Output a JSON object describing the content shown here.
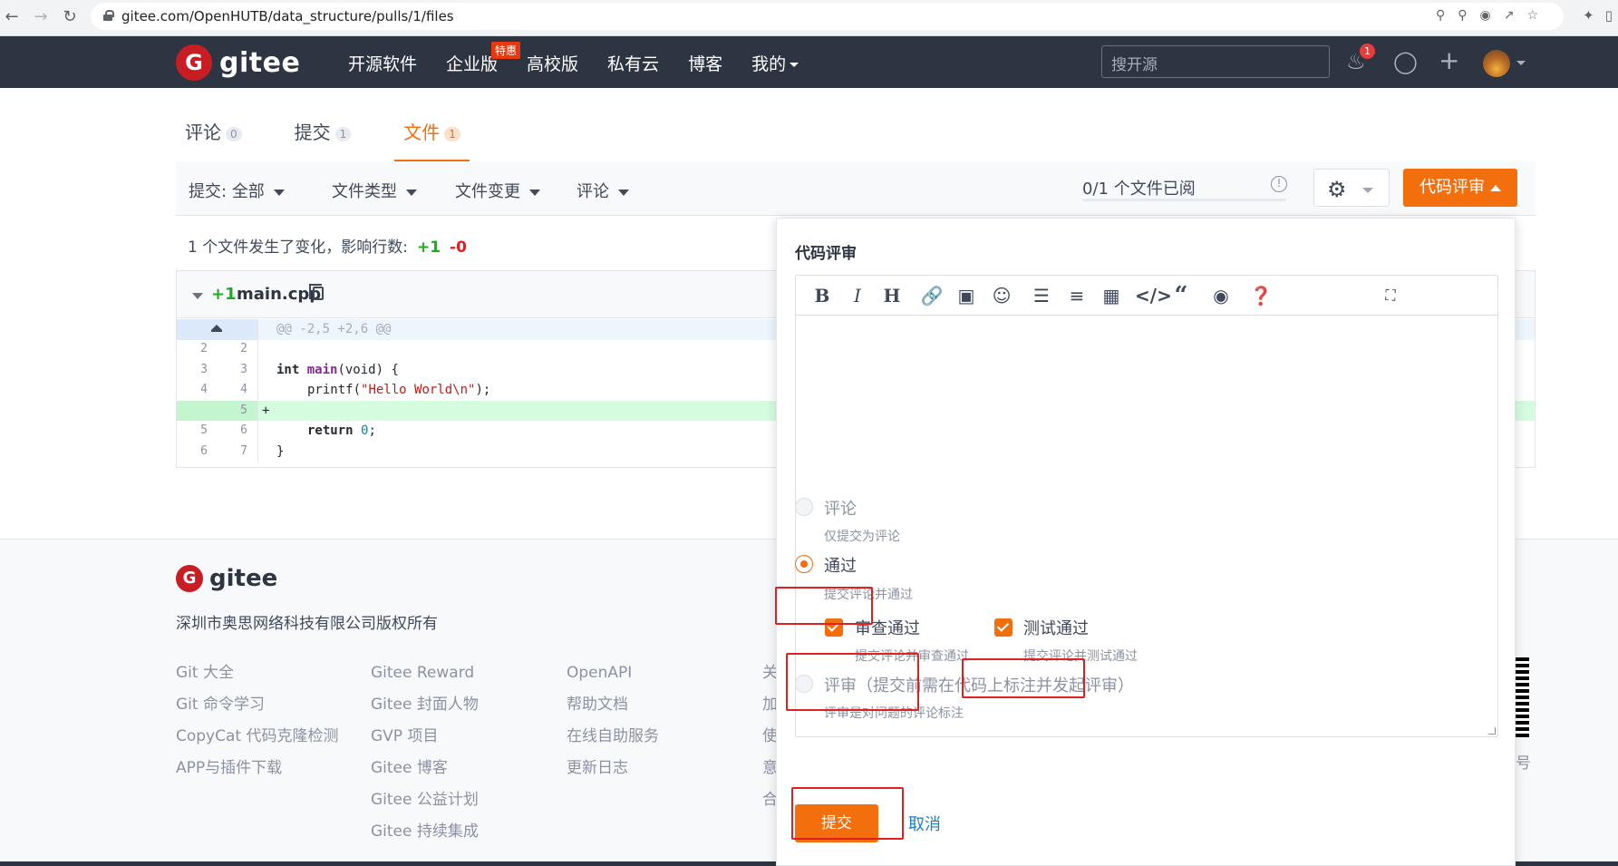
{
  "browser": {
    "url": "gitee.com/OpenHUTB/data_structure/pulls/1/files"
  },
  "header": {
    "logo_text": "gitee",
    "nav": [
      "开源软件",
      "企业版",
      "高校版",
      "私有云",
      "博客",
      "我的"
    ],
    "hot_tag": "特惠",
    "search_placeholder": "搜开源",
    "notification_count": "1"
  },
  "tabs": [
    {
      "label": "评论",
      "count": "0"
    },
    {
      "label": "提交",
      "count": "1"
    },
    {
      "label": "文件",
      "count": "1"
    }
  ],
  "filters": {
    "commit_label": "提交:",
    "commit_value": "全部",
    "file_type": "文件类型",
    "file_change": "文件变更",
    "comment": "评论",
    "read_status": "0/1 个文件已阅",
    "review_button": "代码评审"
  },
  "summary": {
    "text": "1 个文件发生了变化，影响行数:",
    "added": "+1",
    "removed": "-0"
  },
  "diff": {
    "added": "+1",
    "filename": "main.cpp",
    "hunk": "@@ -2,5 +2,6 @@",
    "lines": [
      {
        "old": "2",
        "new": "2"
      },
      {
        "old": "3",
        "new": "3"
      },
      {
        "old": "4",
        "new": "4"
      },
      {
        "old": "",
        "new": "5",
        "marker": "+"
      },
      {
        "old": "5",
        "new": "6"
      },
      {
        "old": "6",
        "new": "7"
      }
    ],
    "code": {
      "l3_kw": "int",
      "l3_fn": "main",
      "l3_rest": "(void) {",
      "l4_pre": "printf(",
      "l4_str": "\"Hello World\\n\"",
      "l4_post": ");",
      "l6_kw": "return",
      "l6_num": "0",
      "l6_post": ";",
      "l7": "}"
    }
  },
  "footer": {
    "logo_text": "gitee",
    "copyright": "深圳市奥思网络科技有限公司版权所有",
    "col1": [
      "Git 大全",
      "Git 命令学习",
      "CopyCat 代码克隆检测",
      "APP与插件下载"
    ],
    "col2": [
      "Gitee Reward",
      "Gitee 封面人物",
      "GVP 项目",
      "Gitee 博客",
      "Gitee 公益计划",
      "Gitee 持续集成"
    ],
    "col3": [
      "OpenAPI",
      "帮助文档",
      "在线自助服务",
      "更新日志"
    ],
    "col4": [
      "关",
      "加",
      "使",
      "意",
      "合"
    ],
    "right_fragment": "号"
  },
  "review_popup": {
    "title": "代码评审",
    "options": {
      "comment": {
        "label": "评论",
        "hint": "仅提交为评论"
      },
      "approve": {
        "label": "通过",
        "hint": "提交评论并通过"
      },
      "review_pass": {
        "label": "审查通过",
        "hint": "提交评论并审查通过"
      },
      "test_pass": {
        "label": "测试通过",
        "hint": "提交评论并测试通过"
      },
      "review": {
        "label": "评审（提交前需在代码上标注并发起评审）",
        "hint": "评审是对问题的评论标注"
      }
    },
    "submit": "提交",
    "cancel": "取消"
  },
  "colors": {
    "accent": "#f36e0d",
    "header_bg": "#2e3542",
    "brand_red": "#c71d23",
    "annotation_red": "#e02020"
  }
}
